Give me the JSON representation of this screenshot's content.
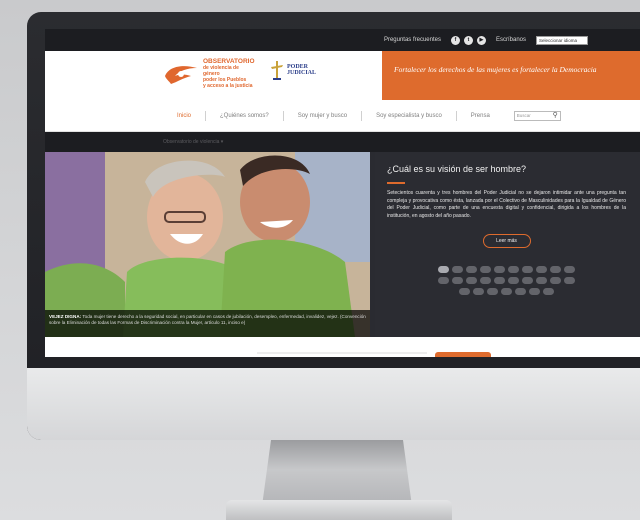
{
  "topbar": {
    "faq_link": "Preguntas frecuentes",
    "social_icons": [
      "facebook-icon",
      "twitter-icon",
      "youtube-icon"
    ],
    "contact_link": "Escríbanos",
    "language_select": "Seleccionar idioma"
  },
  "header": {
    "observatory_logo": {
      "title": "OBSERVATORIO",
      "lines": [
        "de violencia de",
        "género",
        "poder los Pueblos",
        "y acceso a la justicia"
      ]
    },
    "judicial_logo": {
      "line1": "PODER",
      "line2": "JUDICIAL"
    },
    "slogan": "Fortalecer los derechos de las mujeres es fortalecer la Democracia"
  },
  "nav": {
    "items": [
      {
        "label": "Inicio",
        "active": true
      },
      {
        "label": "¿Quiénes somos?",
        "active": false
      },
      {
        "label": "Soy mujer y busco",
        "active": false
      },
      {
        "label": "Soy especialista y busco",
        "active": false
      },
      {
        "label": "Prensa",
        "active": false
      }
    ],
    "search_placeholder": "Buscar"
  },
  "subbar": {
    "crumb": "Observatorio de violencia ▾"
  },
  "hero": {
    "caption_bold": "VEJEZ DIGNA:",
    "caption_text": "Toda mujer tiene derecho a la seguridad social, en particular en casos de jubilación, desempleo, enfermedad, invalidez, vejez. (Convención sobre la Eliminación de todas las Formas de Discriminación contra la Mujer, artículo 11, inciso e)",
    "question": "¿Cuál es su visión de ser hombre?",
    "body": "Setecientos cuarenta y tres hombres del Poder Judicial no se dejaron intimidar ante una pregunta tan compleja y provocativa como ésta, lanzada por el Colectivo de Masculinidades para la Igualdad de Género del Poder Judicial, como parte de una encuesta digital y confidencial, dirigida a los hombres de la institución, en agosto del año pasado.",
    "more_button": "Leer más",
    "pagination_rows": [
      10,
      10,
      7
    ],
    "active_dot": 0
  },
  "colors": {
    "accent": "#de6b2d",
    "dark": "#1c1d21",
    "panel": "#2b2c32"
  }
}
